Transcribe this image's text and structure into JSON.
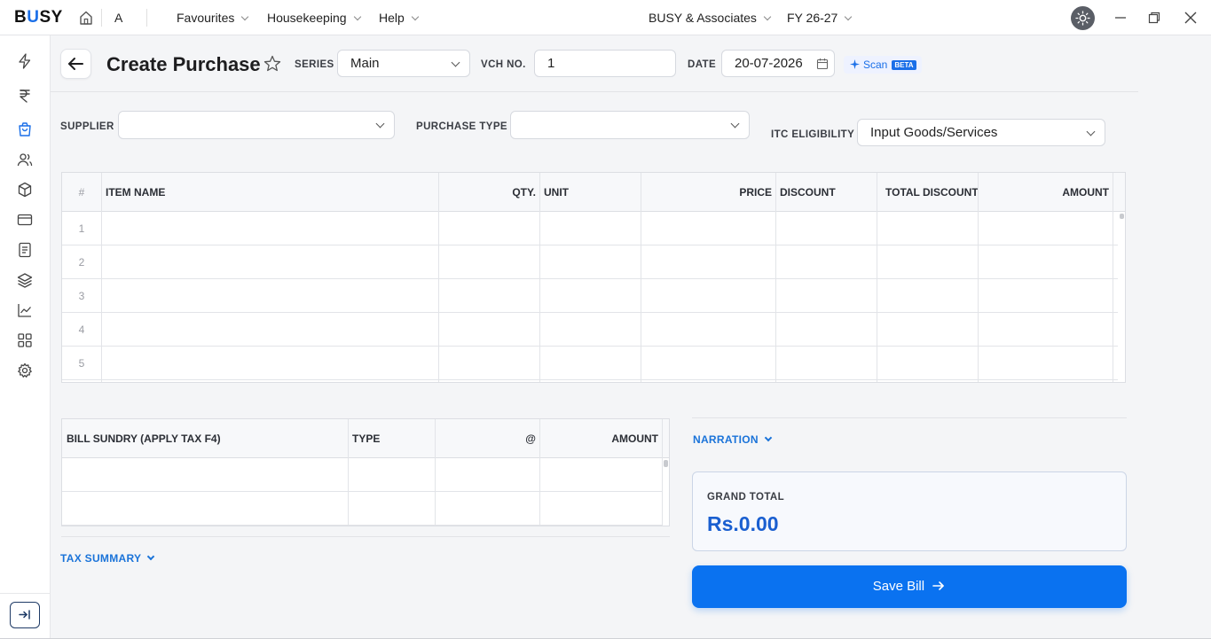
{
  "topbar": {
    "logo_prefix": "B",
    "logo_accent": "U",
    "logo_suffix": "SY",
    "company_letter": "A",
    "menus": [
      "Favourites",
      "Housekeeping",
      "Help"
    ],
    "company_name": "BUSY & Associates",
    "fiscal_year": "FY 26-27"
  },
  "page": {
    "title": "Create Purchase",
    "series_label": "SERIES",
    "series_value": "Main",
    "vch_label": "VCH NO.",
    "vch_value": "1",
    "date_label": "DATE",
    "date_value": "20-07-2026",
    "scan_label": "Scan",
    "beta_label": "BETA"
  },
  "form": {
    "supplier_label": "SUPPLIER",
    "supplier_value": "",
    "purchase_type_label": "PURCHASE TYPE",
    "purchase_type_value": "",
    "itc_label": "ITC ELIGIBILITY",
    "itc_value": "Input Goods/Services"
  },
  "items_table": {
    "headers": [
      "#",
      "ITEM NAME",
      "QTY.",
      "UNIT",
      "PRICE",
      "DISCOUNT",
      "TOTAL DISCOUNT",
      "AMOUNT"
    ],
    "rows": [
      "1",
      "2",
      "3",
      "4",
      "5"
    ]
  },
  "sundry_table": {
    "headers": [
      "BILL SUNDRY (APPLY TAX F4)",
      "TYPE",
      "@",
      "AMOUNT"
    ]
  },
  "narration_label": "NARRATION",
  "tax_summary_label": "TAX SUMMARY",
  "grand_total": {
    "label": "GRAND TOTAL",
    "value": "Rs.0.00"
  },
  "save_label": "Save Bill",
  "colors": {
    "accent": "#0a72f0",
    "total_text": "#1a5fd0",
    "link": "#1a73d9"
  }
}
